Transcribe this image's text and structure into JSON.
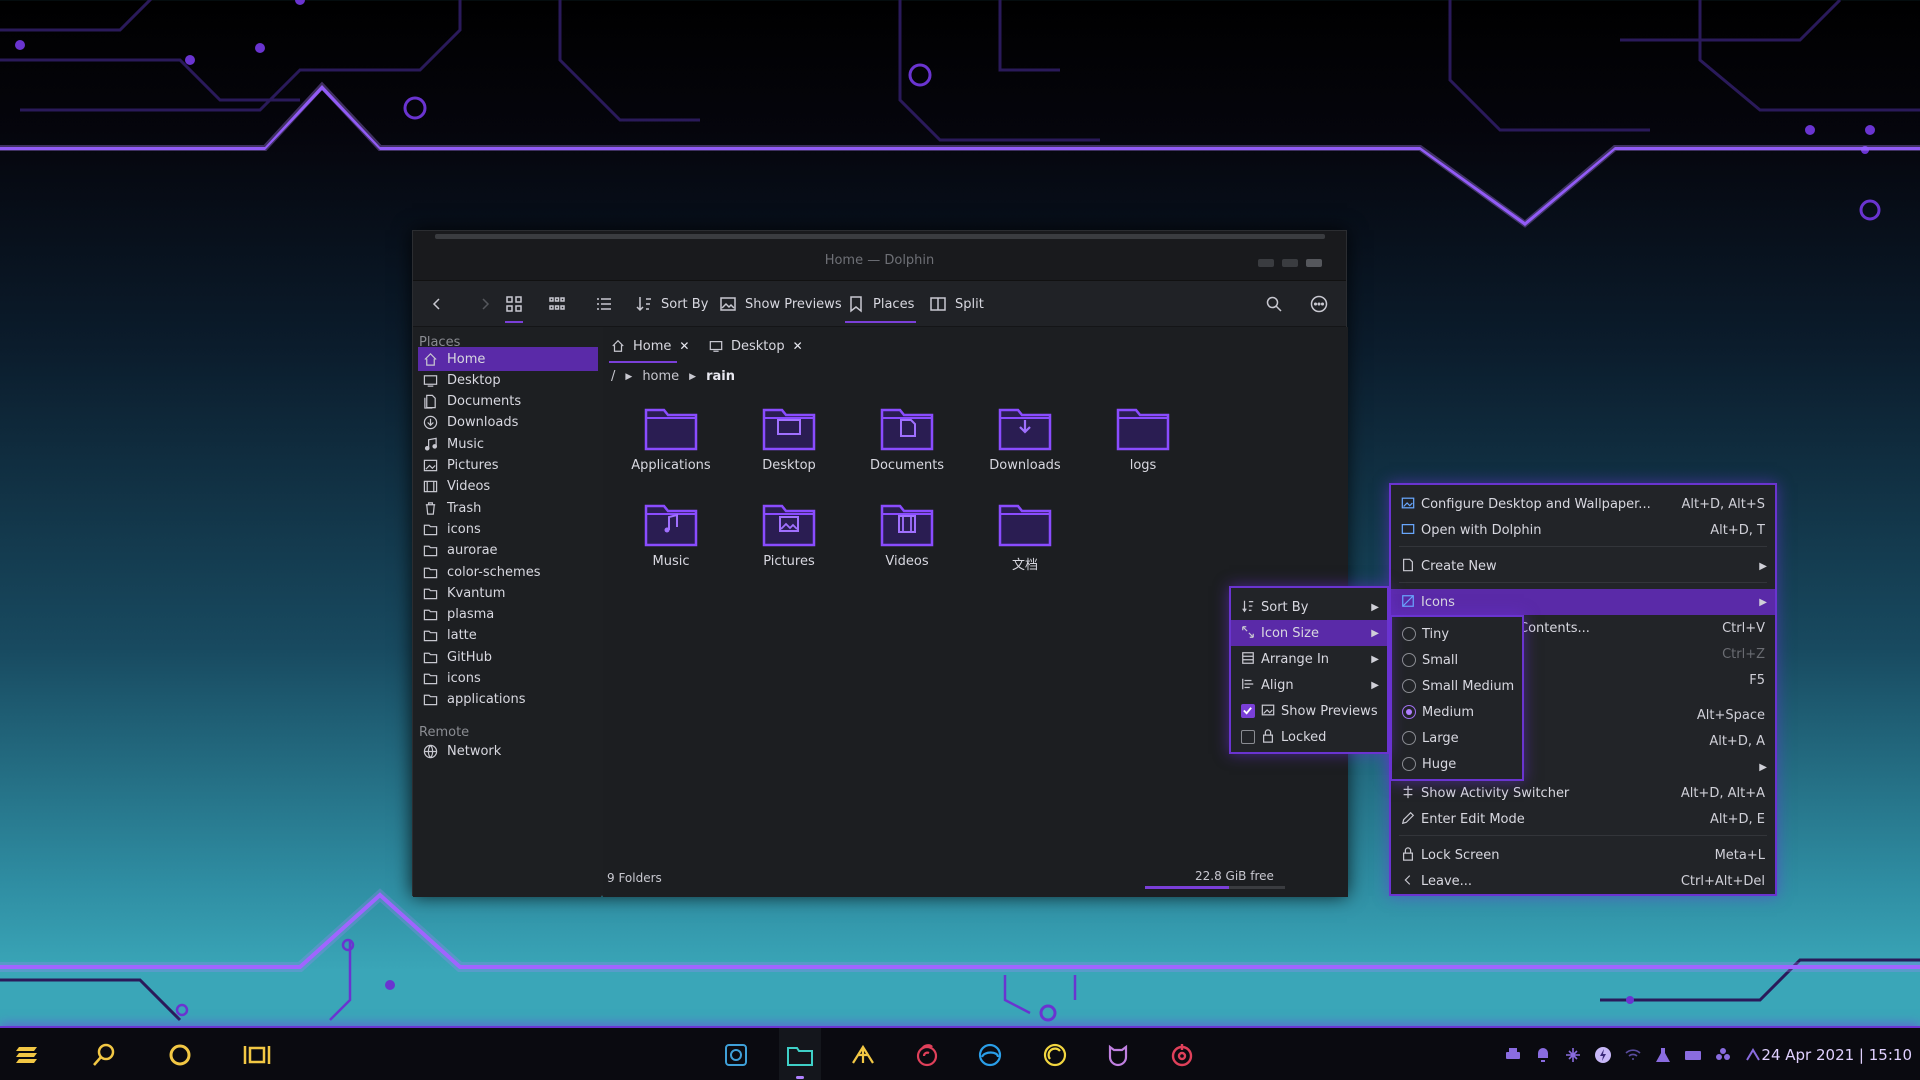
{
  "colors": {
    "accent": "#7a3fd8",
    "highlight": "#5a2aa8",
    "neon": "#9b5cff",
    "folder": "#8a4cff",
    "panel_yellow": "#f2c744"
  },
  "window": {
    "title": "Home — Dolphin",
    "toolbar": {
      "sort_by": "Sort By",
      "show_previews": "Show Previews",
      "places": "Places",
      "split": "Split"
    },
    "sidebar": {
      "places_heading": "Places",
      "items": [
        {
          "label": "Home",
          "icon": "home-icon",
          "selected": true
        },
        {
          "label": "Desktop",
          "icon": "desktop-icon"
        },
        {
          "label": "Documents",
          "icon": "documents-icon"
        },
        {
          "label": "Downloads",
          "icon": "downloads-icon"
        },
        {
          "label": "Music",
          "icon": "music-icon"
        },
        {
          "label": "Pictures",
          "icon": "pictures-icon"
        },
        {
          "label": "Videos",
          "icon": "videos-icon"
        },
        {
          "label": "Trash",
          "icon": "trash-icon"
        },
        {
          "label": "icons",
          "icon": "folder-icon"
        },
        {
          "label": "aurorae",
          "icon": "folder-icon"
        },
        {
          "label": "color-schemes",
          "icon": "folder-icon"
        },
        {
          "label": "Kvantum",
          "icon": "folder-icon"
        },
        {
          "label": "plasma",
          "icon": "folder-icon"
        },
        {
          "label": "latte",
          "icon": "folder-icon"
        },
        {
          "label": "GitHub",
          "icon": "folder-icon"
        },
        {
          "label": "icons",
          "icon": "folder-icon"
        },
        {
          "label": "applications",
          "icon": "folder-icon"
        }
      ],
      "remote_heading": "Remote",
      "network": "Network"
    },
    "tabs": [
      {
        "label": "Home"
      },
      {
        "label": "Desktop"
      }
    ],
    "breadcrumb": {
      "root": "/",
      "home": "home",
      "current": "rain"
    },
    "folders": [
      {
        "name": "Applications",
        "glyph": ""
      },
      {
        "name": "Desktop",
        "glyph": "desktop"
      },
      {
        "name": "Documents",
        "glyph": "doc"
      },
      {
        "name": "Downloads",
        "glyph": "down"
      },
      {
        "name": "logs",
        "glyph": ""
      },
      {
        "name": "Music",
        "glyph": "music"
      },
      {
        "name": "Pictures",
        "glyph": "pic"
      },
      {
        "name": "Videos",
        "glyph": "video"
      },
      {
        "name": "文档",
        "glyph": ""
      }
    ],
    "status": {
      "count": "9 Folders",
      "free": "22.8 GiB free",
      "used_fraction": 0.6
    }
  },
  "desktop_menu": {
    "items": [
      {
        "label": "Configure Desktop and Wallpaper...",
        "shortcut": "Alt+D, Alt+S"
      },
      {
        "label": "Open with Dolphin",
        "shortcut": "Alt+D, T"
      },
      {
        "label": "Create New",
        "shortcut": ""
      },
      {
        "label": "Icons",
        "shortcut": ""
      },
      {
        "label": "Contents...",
        "shortcut": "Ctrl+V"
      },
      {
        "label": "",
        "shortcut": "Ctrl+Z"
      },
      {
        "label": "",
        "shortcut": "F5"
      },
      {
        "label": "",
        "shortcut": "Alt+Space"
      },
      {
        "label": "",
        "shortcut": "Alt+D, A"
      },
      {
        "label": "",
        "shortcut": ""
      },
      {
        "label": "Show Activity Switcher",
        "shortcut": "Alt+D, Alt+A"
      },
      {
        "label": "Enter Edit Mode",
        "shortcut": "Alt+D, E"
      },
      {
        "label": "Lock Screen",
        "shortcut": "Meta+L"
      },
      {
        "label": "Leave...",
        "shortcut": "Ctrl+Alt+Del"
      }
    ]
  },
  "icons_menu": {
    "items": [
      {
        "label": "Sort By"
      },
      {
        "label": "Icon Size"
      },
      {
        "label": "Arrange In"
      },
      {
        "label": "Align"
      },
      {
        "label": "Show Previews",
        "checked": true
      },
      {
        "label": "Locked",
        "checked": false
      }
    ]
  },
  "size_menu": {
    "items": [
      {
        "label": "Tiny",
        "selected": false
      },
      {
        "label": "Small",
        "selected": false
      },
      {
        "label": "Small Medium",
        "selected": false
      },
      {
        "label": "Medium",
        "selected": true
      },
      {
        "label": "Large",
        "selected": false
      },
      {
        "label": "Huge",
        "selected": false
      }
    ]
  },
  "panel": {
    "clock": "24 Apr 2021 | 15:10",
    "launchers": [
      "launcher-menu-icon",
      "search-icon",
      "circle-icon",
      "window-switch-icon"
    ],
    "tasks": [
      "screenshot-app-icon",
      "dolphin-app-icon",
      "krita-app-icon",
      "firefox-app-icon",
      "edge-app-icon",
      "element-app-icon",
      "github-app-icon",
      "app-icon"
    ]
  }
}
